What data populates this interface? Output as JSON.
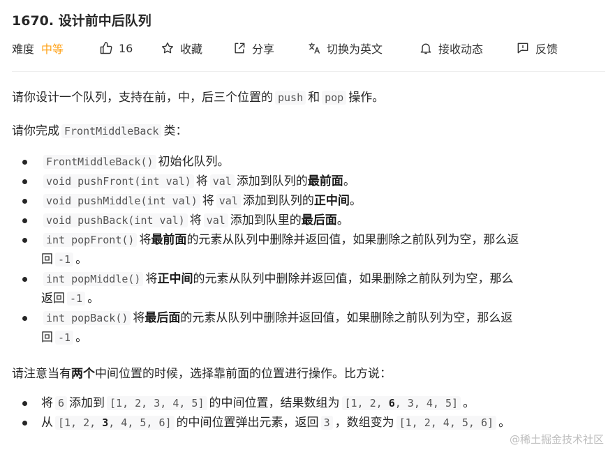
{
  "problem": {
    "title": "1670. 设计前中后队列"
  },
  "toolbar": {
    "difficulty_label": "难度",
    "difficulty_value": "中等",
    "like_count": "16",
    "favorite": "收藏",
    "share": "分享",
    "translate": "切换为英文",
    "subscribe": "接收动态",
    "feedback": "反馈"
  },
  "desc": {
    "p1": {
      "a": "请你设计一个队列，支持在前，中，后三个位置的",
      "c1": "push",
      "b": "和",
      "c2": "pop",
      "d": "操作。"
    },
    "p2": {
      "a": "请你完成",
      "c1": "FrontMiddleBack",
      "b": "类："
    },
    "items": [
      {
        "c1": "FrontMiddleBack()",
        "t1": "初始化队列。"
      },
      {
        "c1": "void pushFront(int val)",
        "t1": "将",
        "c2": "val",
        "t2": "添加到队列的",
        "b": "最前面",
        "t3": "。"
      },
      {
        "c1": "void pushMiddle(int val)",
        "t1": "将",
        "c2": "val",
        "t2": "添加到队列的",
        "b": "正中间",
        "t3": "。"
      },
      {
        "c1": "void pushBack(int val)",
        "t1": "将",
        "c2": "val",
        "t2": "添加到队里的",
        "b": "最后面",
        "t3": "。"
      },
      {
        "c1": "int popFront()",
        "t1": "将",
        "b": "最前面",
        "t2": "的元素从队列中删除并返回值，如果删除之前队列为空，那么返",
        "t3": "回",
        "c2": "-1",
        "t4": "。"
      },
      {
        "c1": "int popMiddle()",
        "t1": "将",
        "b": "正中间",
        "t2": "的元素从队列中删除并返回值，如果删除之前队列为空，那么",
        "t3": "返回",
        "c2": "-1",
        "t4": "。"
      },
      {
        "c1": "int popBack()",
        "t1": "将",
        "b": "最后面",
        "t2": "的元素从队列中删除并返回值，如果删除之前队列为空，那么返",
        "t3": "回",
        "c2": "-1",
        "t4": "。"
      }
    ],
    "p3": {
      "a": "请注意当有",
      "b": "两个",
      "c": "中间位置的时候，选择靠前面的位置进行操作。比方说："
    },
    "examples": [
      {
        "t1": "将",
        "c1": "6",
        "t2": "添加到",
        "c2a": "[1, 2, 3, 4, 5]",
        "t3": "的中间位置，结果数组为",
        "c3a": "[1, 2, ",
        "c3b": "6",
        "c3c": ", 3, 4, 5]",
        "t4": "。"
      },
      {
        "t1": "从",
        "c1a": "[1, 2, ",
        "c1b": "3",
        "c1c": ", 4, 5, 6]",
        "t2": "的中间位置弹出元素，返回",
        "c2": "3",
        "t3": "，数组变为",
        "c3": "[1, 2, 4, 5, 6]",
        "t4": "。"
      }
    ]
  },
  "watermark": "@稀土掘金技术社区"
}
